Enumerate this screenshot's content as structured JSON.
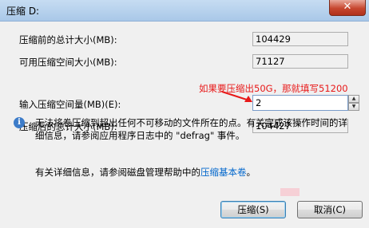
{
  "window": {
    "title": "压缩 D:",
    "close_glyph": "✕"
  },
  "fields": {
    "total_before_label": "压缩前的总计大小(MB):",
    "total_before_value": "104429",
    "available_label": "可用压缩空间大小(MB):",
    "available_value": "71127",
    "input_label": "输入压缩空间量(MB)(E):",
    "input_value": "2",
    "total_after_label": "压缩后的总计大小(MB):",
    "total_after_value": "104427"
  },
  "annotation": {
    "text": "如果要压缩出50G，那就填写51200",
    "color": "#e81818"
  },
  "info": {
    "icon": "info-icon",
    "text": "无法将卷压缩到超出任何不可移动的文件所在的点。有关完成该操作时间的详细信息，请参阅应用程序日志中的 \"defrag\" 事件。"
  },
  "details": {
    "prefix": "有关详细信息，请参阅磁盘管理帮助中的",
    "link": "压缩基本卷",
    "suffix": "。"
  },
  "buttons": {
    "shrink": "压缩(S)",
    "cancel": "取消(C)"
  },
  "colors": {
    "link": "#0066cc",
    "title_bar": "#b8d2ee",
    "close_button": "#c7472f"
  }
}
